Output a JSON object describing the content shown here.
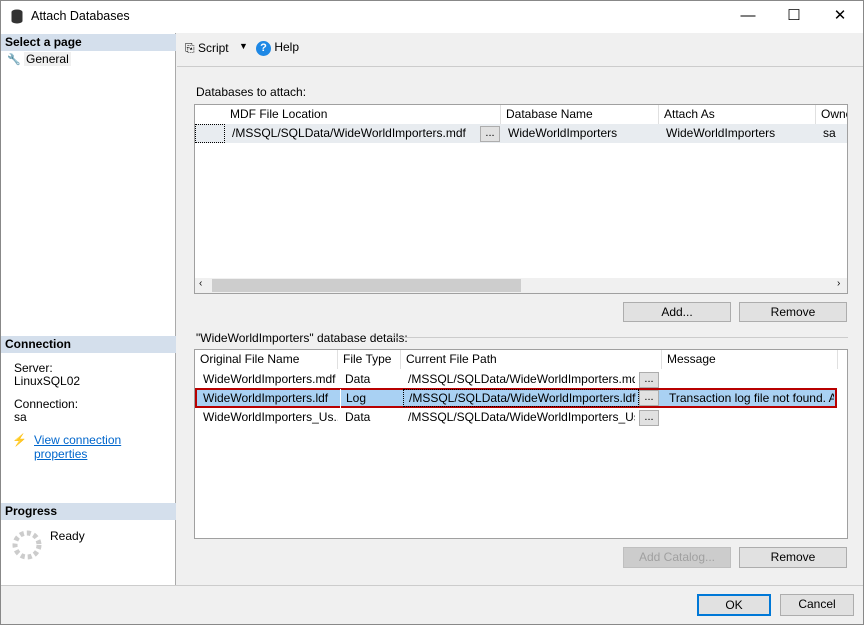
{
  "window": {
    "title": "Attach Databases",
    "minimize": "—",
    "maximize": "☐",
    "close": "✕"
  },
  "sidebar": {
    "select_page": "Select a page",
    "pages": [
      {
        "label": "General",
        "icon": "wrench-icon"
      }
    ],
    "connection_header": "Connection",
    "server_label": "Server:",
    "server_value": "LinuxSQL02",
    "connection_label": "Connection:",
    "connection_value": "sa",
    "view_props": "View connection properties",
    "progress_header": "Progress",
    "progress_status": "Ready"
  },
  "toolbar": {
    "script": "Script",
    "help": "Help"
  },
  "attach": {
    "label": "Databases to attach:",
    "columns": [
      "MDF File Location",
      "Database Name",
      "Attach As",
      "Owner"
    ],
    "rows": [
      {
        "mdf": "/MSSQL/SQLData/WideWorldImporters.mdf",
        "db": "WideWorldImporters",
        "as": "WideWorldImporters",
        "owner": "sa"
      }
    ],
    "add": "Add...",
    "remove": "Remove",
    "browse": "..."
  },
  "details": {
    "label": "\"WideWorldImporters\" database details:",
    "columns": [
      "Original File Name",
      "File Type",
      "Current File Path",
      "Message"
    ],
    "rows": [
      {
        "name": "WideWorldImporters.mdf",
        "type": "Data",
        "path": "/MSSQL/SQLData/WideWorldImporters.mdf",
        "msg": ""
      },
      {
        "name": "WideWorldImporters.ldf",
        "type": "Log",
        "path": "/MSSQL/SQLData/WideWorldImporters.ldf",
        "msg": "Transaction log file not found. A..."
      },
      {
        "name": "WideWorldImporters_Us...",
        "type": "Data",
        "path": "/MSSQL/SQLData/WideWorldImporters_Us...",
        "msg": ""
      }
    ],
    "add_catalog": "Add Catalog...",
    "remove": "Remove"
  },
  "footer": {
    "ok": "OK",
    "cancel": "Cancel"
  }
}
